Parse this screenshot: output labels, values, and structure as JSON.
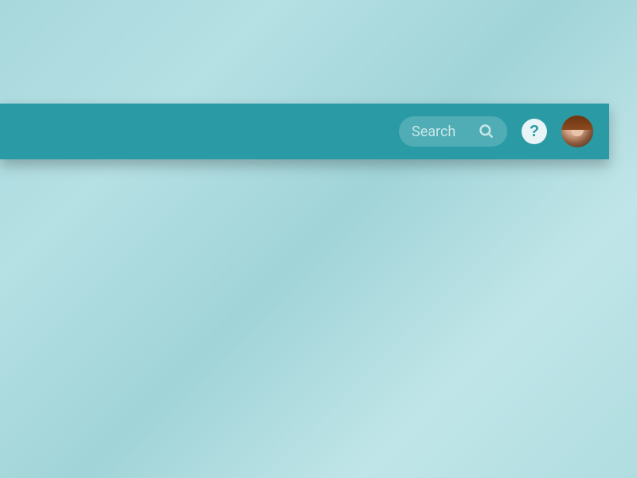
{
  "toolbar": {
    "search": {
      "placeholder": "Search",
      "value": ""
    },
    "help": {
      "label": "?"
    }
  }
}
